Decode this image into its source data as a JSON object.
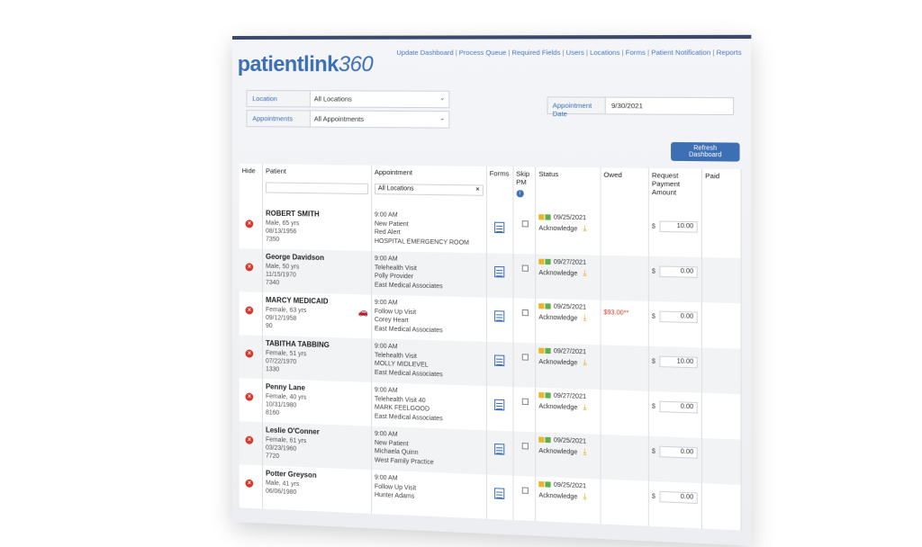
{
  "brand": {
    "name": "patientlink",
    "suffix": "360",
    "color": "#3c6fb4"
  },
  "nav": [
    "Update Dashboard",
    "Process Queue",
    "Required Fields",
    "Users",
    "Locations",
    "Forms",
    "Patient Notification",
    "Reports"
  ],
  "filters": {
    "location_label": "Location",
    "location_value": "All Locations",
    "appointments_label": "Appointments",
    "appointments_value": "All Appointments",
    "appt_date_label": "Appointment Date",
    "appt_date_value": "9/30/2021"
  },
  "refresh_label": "Refresh Dashboard",
  "columns": {
    "hide": "Hide",
    "patient": "Patient",
    "appointment": "Appointment",
    "forms": "Forms",
    "skip": "Skip PM",
    "status": "Status",
    "owed": "Owed",
    "request": "Request Payment Amount",
    "paid": "Paid"
  },
  "appointment_filter": "All Locations",
  "rows": [
    {
      "name": "ROBERT SMITH",
      "info": "Male, 65 yrs",
      "dob": "08/13/1956",
      "id": "7350",
      "time": "9:00 AM",
      "type": "New Patient",
      "provider": "Red Alert",
      "location": "HOSPITAL EMERGENCY ROOM",
      "date": "09/25/2021",
      "status": "Acknowledge",
      "owed": "",
      "amount": "10.00"
    },
    {
      "name": "George Davidson",
      "info": "Male, 50 yrs",
      "dob": "11/15/1970",
      "id": "7340",
      "time": "9:00 AM",
      "type": "Telehealth Visit",
      "provider": "Polly Provider",
      "location": "East Medical Associates",
      "date": "09/27/2021",
      "status": "Acknowledge",
      "owed": "",
      "amount": "0.00"
    },
    {
      "name": "MARCY MEDICAID",
      "info": "Female, 63 yrs",
      "dob": "09/12/1958",
      "id": "90",
      "time": "9:00 AM",
      "type": "Follow Up Visit",
      "provider": "Corey Heart",
      "location": "East Medical Associates",
      "date": "09/25/2021",
      "status": "Acknowledge",
      "owed": "$93.00**",
      "amount": "0.00"
    },
    {
      "name": "TABITHA TABBING",
      "info": "Female, 51 yrs",
      "dob": "07/22/1970",
      "id": "1330",
      "time": "9:00 AM",
      "type": "Telehealth Visit",
      "provider": "MOLLY MIDLEVEL",
      "location": "East Medical Associates",
      "date": "09/27/2021",
      "status": "Acknowledge",
      "owed": "",
      "amount": "10.00"
    },
    {
      "name": "Penny Lane",
      "info": "Female, 40 yrs",
      "dob": "10/31/1980",
      "id": "8160",
      "time": "9:00 AM",
      "type": "Telehealth Visit 40",
      "provider": "MARK FEELGOOD",
      "location": "East Medical Associates",
      "date": "09/27/2021",
      "status": "Acknowledge",
      "owed": "",
      "amount": "0.00"
    },
    {
      "name": "Leslie O'Conner",
      "info": "Female, 61 yrs",
      "dob": "03/23/1960",
      "id": "7720",
      "time": "9:00 AM",
      "type": "New Patient",
      "provider": "Michaela Quinn",
      "location": "West Family Practice",
      "date": "09/25/2021",
      "status": "Acknowledge",
      "owed": "",
      "amount": "0.00"
    },
    {
      "name": "Potter Greyson",
      "info": "Male, 41 yrs",
      "dob": "06/06/1980",
      "id": "",
      "time": "9:00 AM",
      "type": "Follow Up Visit",
      "provider": "Hunter Adams",
      "location": "",
      "date": "09/25/2021",
      "status": "Acknowledge",
      "owed": "",
      "amount": "0.00"
    }
  ],
  "currency": "$"
}
